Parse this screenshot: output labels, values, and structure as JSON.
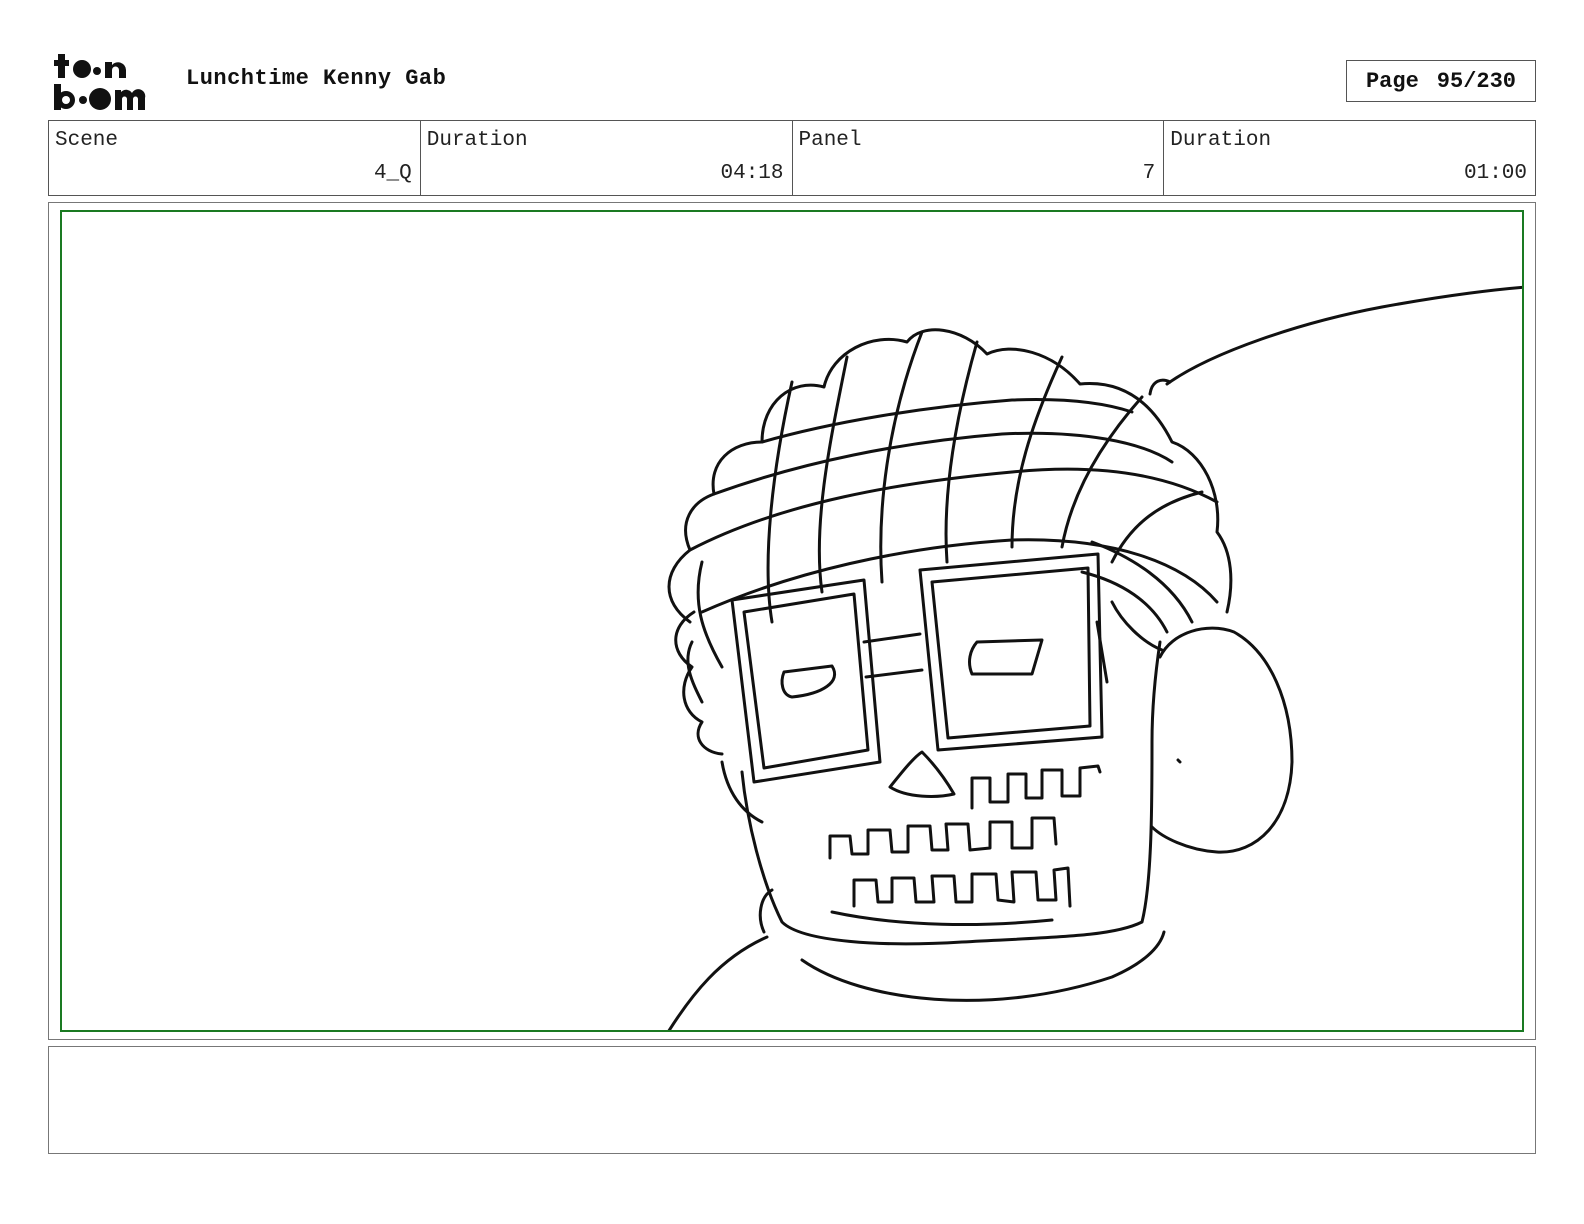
{
  "header": {
    "logo_text": "toon boom",
    "project_title": "Lunchtime Kenny Gab",
    "page_label": "Page",
    "page_value": "95/230"
  },
  "info": {
    "scene_label": "Scene",
    "scene_value": "4_Q",
    "scene_duration_label": "Duration",
    "scene_duration_value": "04:18",
    "panel_label": "Panel",
    "panel_value": "7",
    "panel_duration_label": "Duration",
    "panel_duration_value": "01:00"
  },
  "notes": {
    "text": ""
  }
}
